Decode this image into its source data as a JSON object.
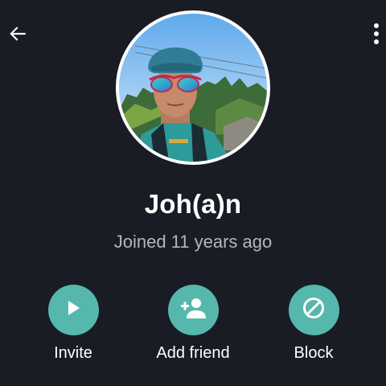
{
  "header": {
    "back_icon": "arrow-left-icon",
    "more_icon": "more-vertical-icon"
  },
  "profile": {
    "name": "Joh(a)n",
    "joined": "Joined 11 years ago"
  },
  "actions": [
    {
      "label": "Invite",
      "icon": "play-icon"
    },
    {
      "label": "Add friend",
      "icon": "person-add-icon"
    },
    {
      "label": "Block",
      "icon": "block-icon"
    }
  ],
  "colors": {
    "background": "#191c25",
    "accent": "#56b8ac",
    "text_primary": "#ffffff",
    "text_secondary": "#b3b6bd"
  }
}
